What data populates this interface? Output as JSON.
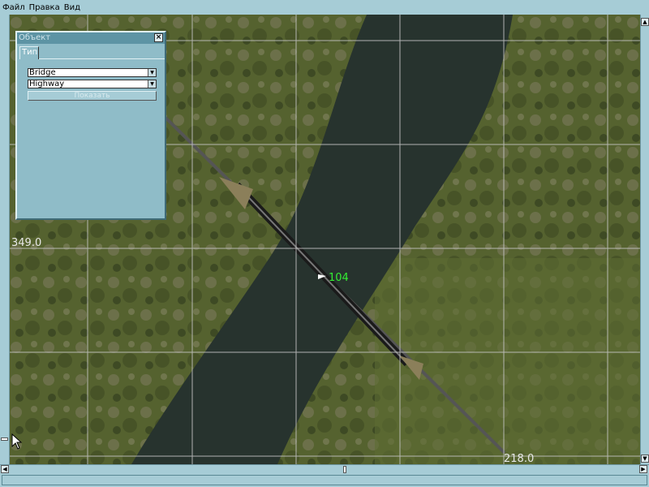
{
  "menu": {
    "items": [
      "Файл",
      "Правка",
      "Вид"
    ]
  },
  "panel": {
    "title": "Объект",
    "tab": "Тип",
    "type_select": "Bridge",
    "subtype_select": "Highway",
    "show_button": "Показать"
  },
  "map": {
    "grid_label_y": "349.0",
    "grid_label_x": "218.0",
    "object_id": "104",
    "object_color": "#33ee33"
  }
}
